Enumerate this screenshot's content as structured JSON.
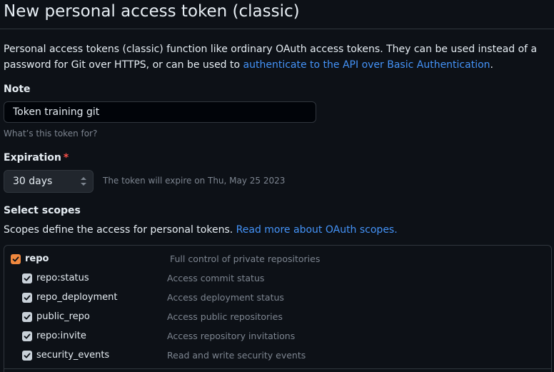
{
  "page": {
    "title": "New personal access token (classic)",
    "intro_text": "Personal access tokens (classic) function like ordinary OAuth access tokens. They can be used instead of a password for Git over HTTPS, or can be used to ",
    "intro_link": "authenticate to the API over Basic Authentication",
    "intro_end": "."
  },
  "note": {
    "label": "Note",
    "value": "Token training git",
    "hint": "What’s this token for?"
  },
  "expiration": {
    "label": "Expiration",
    "required_mark": "*",
    "selected": "30 days",
    "note": "The token will expire on Thu, May 25 2023"
  },
  "scopes": {
    "heading": "Select scopes",
    "description": "Scopes define the access for personal tokens. ",
    "link": "Read more about OAuth scopes.",
    "items": [
      {
        "name": "repo",
        "description": "Full control of private repositories",
        "checked": true,
        "parent": true
      },
      {
        "name": "repo:status",
        "description": "Access commit status",
        "checked": true,
        "parent": false
      },
      {
        "name": "repo_deployment",
        "description": "Access deployment status",
        "checked": true,
        "parent": false
      },
      {
        "name": "public_repo",
        "description": "Access public repositories",
        "checked": true,
        "parent": false
      },
      {
        "name": "repo:invite",
        "description": "Access repository invitations",
        "checked": true,
        "parent": false
      },
      {
        "name": "security_events",
        "description": "Read and write security events",
        "checked": true,
        "parent": false
      }
    ]
  },
  "colors": {
    "background": "#0d1117",
    "link": "#4493f8",
    "parent_checkbox": "#f0883e",
    "child_checkbox": "#c9d1d9",
    "muted_text": "#7d8590"
  }
}
